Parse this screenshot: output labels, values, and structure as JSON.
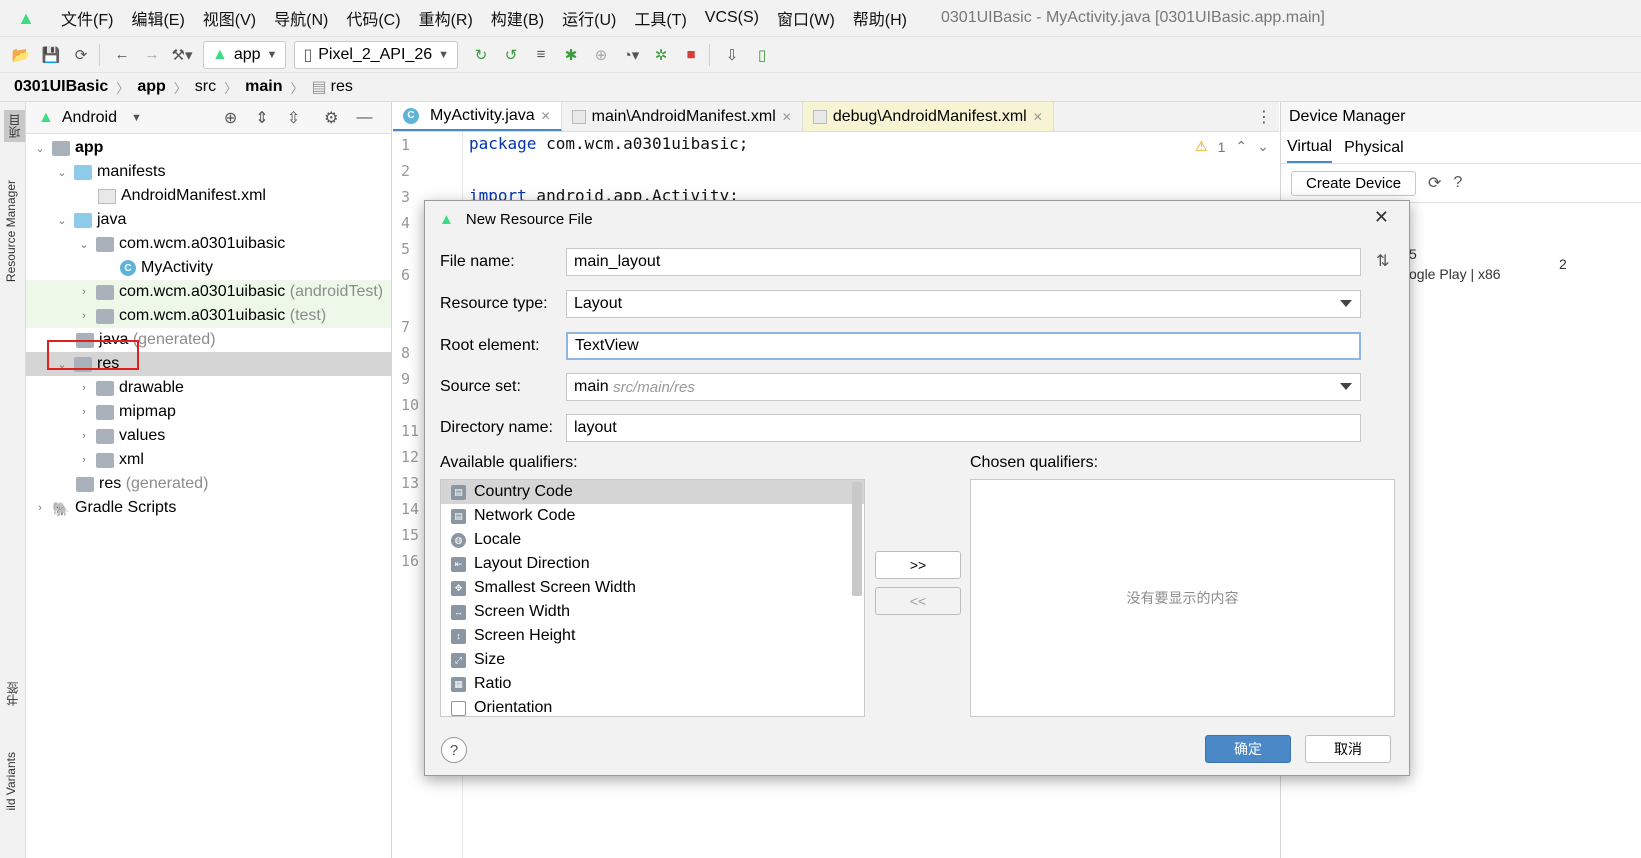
{
  "menubar": {
    "items": [
      "文件(F)",
      "编辑(E)",
      "视图(V)",
      "导航(N)",
      "代码(C)",
      "重构(R)",
      "构建(B)",
      "运行(U)",
      "工具(T)",
      "VCS(S)",
      "窗口(W)",
      "帮助(H)"
    ],
    "window_title": "0301UIBasic - MyActivity.java [0301UIBasic.app.main]"
  },
  "toolbar": {
    "run_config": "app",
    "device": "Pixel_2_API_26"
  },
  "breadcrumb": [
    "0301UIBasic",
    "app",
    "src",
    "main",
    "res"
  ],
  "left_strip": {
    "project_label": "项目",
    "resource_manager_label": "Resource Manager",
    "bookmarks_label": "书签",
    "build_variants_label": "ild Variants"
  },
  "project_panel": {
    "view_label": "Android",
    "tree": [
      {
        "label": "app",
        "suffix": ""
      },
      {
        "label": "manifests",
        "suffix": ""
      },
      {
        "label": "AndroidManifest.xml",
        "suffix": ""
      },
      {
        "label": "java",
        "suffix": ""
      },
      {
        "label": "com.wcm.a0301uibasic",
        "suffix": ""
      },
      {
        "label": "MyActivity",
        "suffix": ""
      },
      {
        "label": "com.wcm.a0301uibasic",
        "suffix": "(androidTest)"
      },
      {
        "label": "com.wcm.a0301uibasic",
        "suffix": "(test)"
      },
      {
        "label": "java",
        "suffix": "(generated)"
      },
      {
        "label": "res",
        "suffix": ""
      },
      {
        "label": "drawable",
        "suffix": ""
      },
      {
        "label": "mipmap",
        "suffix": ""
      },
      {
        "label": "values",
        "suffix": ""
      },
      {
        "label": "xml",
        "suffix": ""
      },
      {
        "label": "res",
        "suffix": "(generated)"
      },
      {
        "label": "Gradle Scripts",
        "suffix": ""
      }
    ]
  },
  "editor": {
    "tabs": [
      "MyActivity.java",
      "main\\AndroidManifest.xml",
      "debug\\AndroidManifest.xml"
    ],
    "line_numbers": [
      "1",
      "2",
      "3",
      "4",
      "5",
      "6",
      "7",
      "8",
      "9",
      "10",
      "11",
      "12",
      "13",
      "14",
      "15",
      "16"
    ],
    "line1_keyword": "package",
    "line1_rest": " com.wcm.a0301uibasic;",
    "line3_keyword": "import",
    "line3_rest": " android.app.Activity;",
    "warning_count": "1"
  },
  "device_manager": {
    "title": "Device Manager",
    "tabs": [
      "Virtual",
      "Physical"
    ],
    "create_button": "Create Device",
    "partial_text1": "5",
    "partial_text2": "ogle Play | x86",
    "partial_text3": "2"
  },
  "dialog": {
    "title": "New Resource File",
    "file_name_label": "File name:",
    "file_name_value": "main_layout",
    "resource_type_label": "Resource type:",
    "resource_type_value": "Layout",
    "root_element_label": "Root element:",
    "root_element_value": "TextView",
    "source_set_label": "Source set:",
    "source_set_value": "main",
    "source_set_hint": "src/main/res",
    "directory_label": "Directory name:",
    "directory_value": "layout",
    "available_label": "Available qualifiers:",
    "chosen_label": "Chosen qualifiers:",
    "qualifiers": [
      "Country Code",
      "Network Code",
      "Locale",
      "Layout Direction",
      "Smallest Screen Width",
      "Screen Width",
      "Screen Height",
      "Size",
      "Ratio",
      "Orientation"
    ],
    "empty_text": "没有要显示的内容",
    "add_button": ">>",
    "remove_button": "<<",
    "ok_button": "确定",
    "cancel_button": "取消",
    "help": "?"
  }
}
